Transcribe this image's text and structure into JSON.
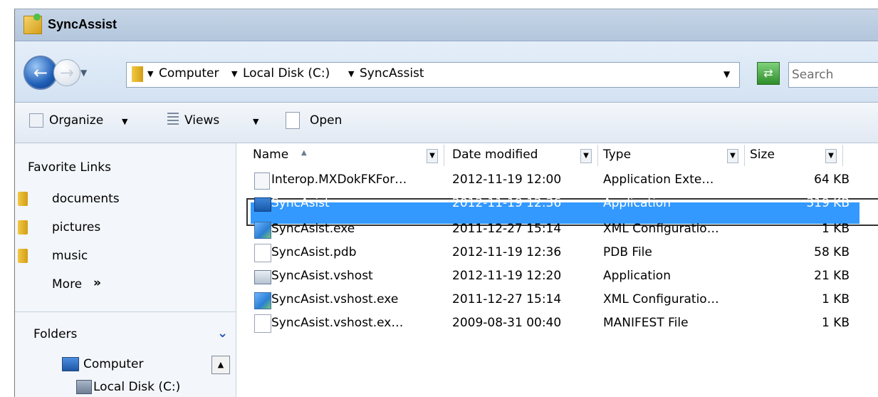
{
  "window": {
    "title": "SyncAssist"
  },
  "address": {
    "crumbs": [
      "Computer",
      "Local Disk (C:)",
      "SyncAssist"
    ],
    "search_placeholder": "Search"
  },
  "toolbar": {
    "organize": "Organize",
    "views": "Views",
    "open": "Open"
  },
  "nav": {
    "favorites_header": "Favorite Links",
    "favorites": [
      "documents",
      "pictures",
      "music"
    ],
    "more": "More",
    "folders_header": "Folders",
    "tree": [
      "Computer",
      "Local Disk (C:)"
    ]
  },
  "columns": {
    "name": "Name",
    "date": "Date modified",
    "type": "Type",
    "size": "Size"
  },
  "files": [
    {
      "name": "Interop.MXDokFKFor…",
      "date": "2012-11-19 12:00",
      "type": "Application Exte…",
      "size": "64 KB",
      "icon": "dll-icon"
    },
    {
      "name": "SyncAsist",
      "date": "2012-11-19 12:36",
      "type": "Application",
      "size": "319 KB",
      "icon": "app-icon",
      "selected": true
    },
    {
      "name": "SyncAsist.exe",
      "date": "2011-12-27 15:14",
      "type": "XML Configuratio…",
      "size": "1 KB",
      "icon": "config-icon"
    },
    {
      "name": "SyncAsist.pdb",
      "date": "2012-11-19 12:36",
      "type": "PDB File",
      "size": "58 KB",
      "icon": "file-icon"
    },
    {
      "name": "SyncAsist.vshost",
      "date": "2012-11-19 12:20",
      "type": "Application",
      "size": "21 KB",
      "icon": "app-icon"
    },
    {
      "name": "SyncAsist.vshost.exe",
      "date": "2011-12-27 15:14",
      "type": "XML Configuratio…",
      "size": "1 KB",
      "icon": "config-icon"
    },
    {
      "name": "SyncAsist.vshost.ex…",
      "date": "2009-08-31 00:40",
      "type": "MANIFEST File",
      "size": "1 KB",
      "icon": "file-icon"
    }
  ],
  "colors": {
    "selection": "#3399ff",
    "titlebar": "#c6d5e6"
  }
}
